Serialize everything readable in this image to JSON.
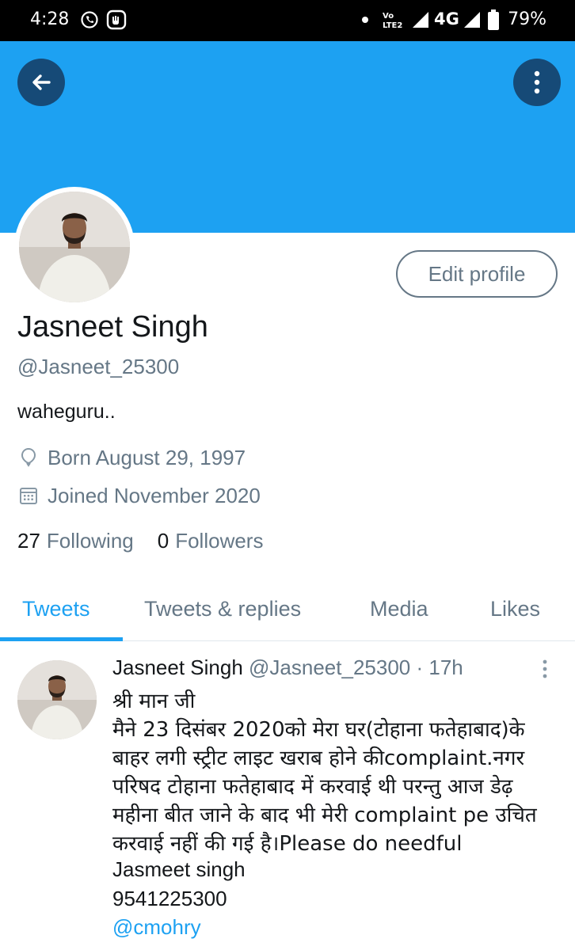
{
  "status_bar": {
    "time": "4:28",
    "network": "4G",
    "volte_label": "VoLTE2",
    "battery_percent": "79%"
  },
  "profile": {
    "name": "Jasneet Singh",
    "handle": "@Jasneet_25300",
    "bio": "waheguru..",
    "born": "Born August 29, 1997",
    "joined": "Joined November 2020",
    "following_count": "27",
    "following_label": "Following",
    "followers_count": "0",
    "followers_label": "Followers",
    "edit_button_label": "Edit profile"
  },
  "tabs": [
    {
      "label": "Tweets",
      "active": true
    },
    {
      "label": "Tweets & replies",
      "active": false
    },
    {
      "label": "Media",
      "active": false
    },
    {
      "label": "Likes",
      "active": false
    }
  ],
  "tweet": {
    "author_name": "Jasneet Singh",
    "author_handle": "@Jasneet_25300",
    "separator": "·",
    "time": "17h",
    "lines": [
      "श्री मान जी",
      "मैने 23 दिसंबर 2020को मेरा घर(टोहाना फतेहाबाद)के",
      "बाहर लगी स्ट्रीट लाइट खराब होने कीcomplaint.नगर",
      "परिषद टोहाना फतेहाबाद  में करवाई थी परन्तु आज डेढ़",
      "महीना बीत जाने के बाद भी मेरी complaint pe उचित",
      "करवाई नहीं की गई है।Please do needful",
      "Jasmeet singh",
      "9541225300"
    ],
    "mention": "@cmohry"
  },
  "colors": {
    "accent": "#1da1f2",
    "secondary_text": "#657786",
    "primary_text": "#14171a"
  },
  "icons": {
    "back": "arrow-left-icon",
    "more": "more-vertical-icon",
    "born": "balloon-icon",
    "joined": "calendar-icon",
    "whatsapp": "whatsapp-icon",
    "signal": "signal-icon",
    "battery": "battery-icon"
  }
}
